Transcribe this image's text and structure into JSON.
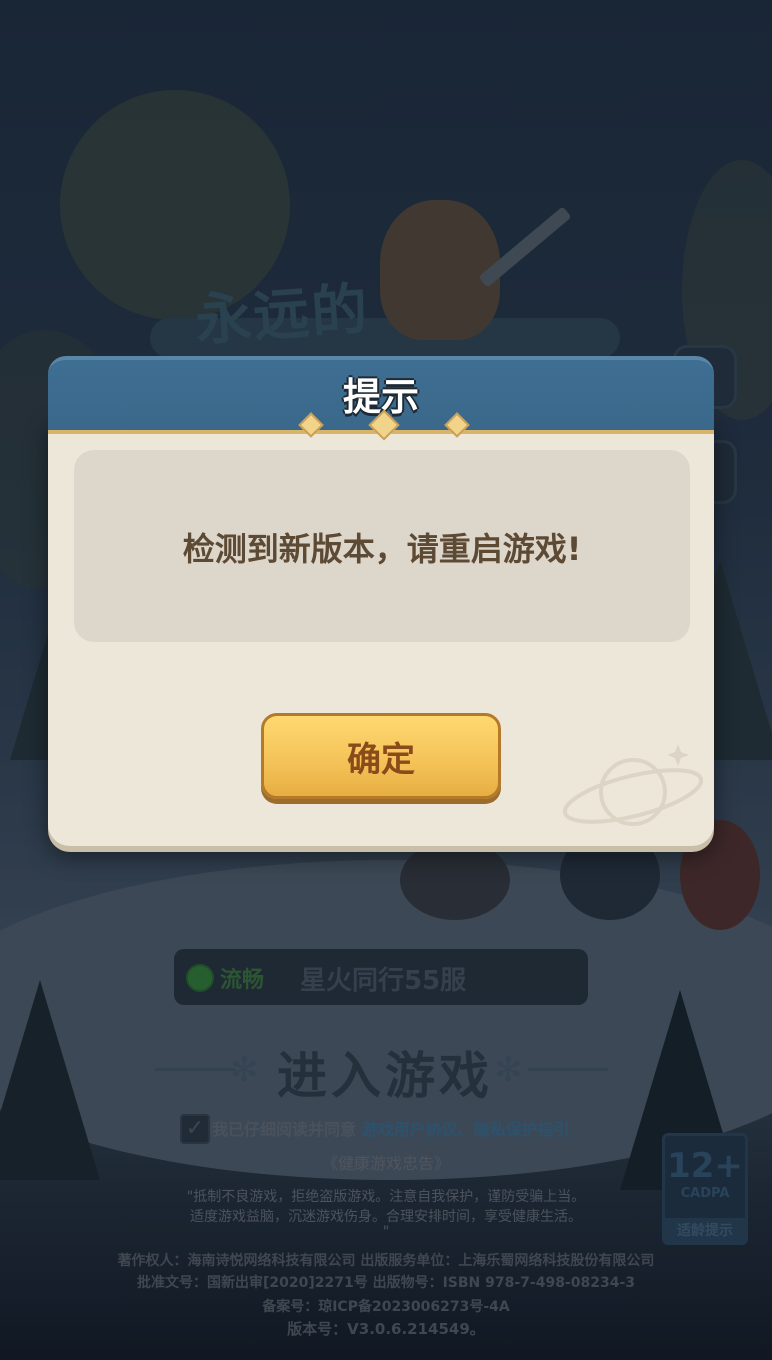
{
  "background": {
    "server": {
      "status": "流畅",
      "name": "星火同行55服"
    },
    "enter_game_label": "进入游戏",
    "agreement": {
      "prefix": "我已仔细阅读并同意",
      "link": "游戏用户协议、隐私保护指引"
    },
    "health_notice_title": "《健康游戏忠告》",
    "health_notice_lines": [
      "\"抵制不良游戏，拒绝盗版游戏。注意自我保护，谨防受骗上当。",
      "适度游戏益脑，沉迷游戏伤身。合理安排时间，享受健康生活。",
      "\""
    ],
    "credits": [
      "著作权人：海南诗悦网络科技有限公司 出版服务单位：上海乐蜀网络科技股份有限公司",
      "批准文号：国新出审[2020]2271号 出版物号：ISBN 978-7-498-08234-3",
      "备案号：琼ICP备2023006273号-4A",
      "版本号：V3.0.6.214549。"
    ],
    "age_rating": {
      "number": "12+",
      "org": "CADPA",
      "hint": "适龄提示"
    },
    "logo_text": "永远的"
  },
  "dialog": {
    "title": "提示",
    "message": "检测到新版本，请重启游戏!",
    "confirm_label": "确定"
  },
  "colors": {
    "dialog_header": "#3a688a",
    "dialog_body": "#ede7d9",
    "button": "#f3c257",
    "button_text": "#8a4b1a"
  }
}
